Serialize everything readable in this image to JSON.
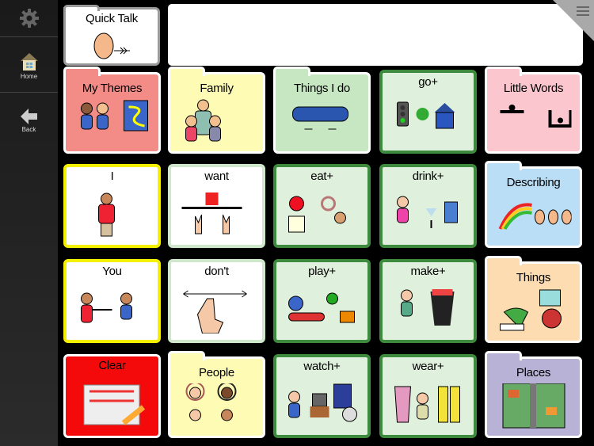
{
  "sidebar": {
    "settings_icon": "gear-icon",
    "home_label": "Home",
    "back_label": "Back"
  },
  "message_bar": {
    "text": ""
  },
  "menu_icon": "hamburger-icon",
  "quick_talk": {
    "label": "Quick Talk",
    "icon": "speaking-face",
    "bg": "#ffffff",
    "border": "#9a9a9a"
  },
  "grid": [
    {
      "label": "My Themes",
      "type": "folder",
      "bg": "#f38b87",
      "border": "#ffffff",
      "icon": "themes"
    },
    {
      "label": "Family",
      "type": "folder",
      "bg": "#fdfbb4",
      "border": "#ffffff",
      "icon": "family"
    },
    {
      "label": "Things I do",
      "type": "folder",
      "bg": "#c6e7c2",
      "border": "#ffffff",
      "icon": "hands"
    },
    {
      "label": "go+",
      "type": "button",
      "bg": "#dff0dc",
      "border": "#3e8a3e",
      "icon": "go"
    },
    {
      "label": "Little Words",
      "type": "folder",
      "bg": "#fcc6cf",
      "border": "#ffffff",
      "icon": "little-words"
    },
    {
      "label": "I",
      "type": "button",
      "bg": "#ffffff",
      "border": "#f5f000",
      "icon": "person"
    },
    {
      "label": "want",
      "type": "button",
      "bg": "#ffffff",
      "border": "#cfe8cc",
      "icon": "want"
    },
    {
      "label": "eat+",
      "type": "button",
      "bg": "#dff0dc",
      "border": "#3e8a3e",
      "icon": "eat"
    },
    {
      "label": "drink+",
      "type": "button",
      "bg": "#dff0dc",
      "border": "#3e8a3e",
      "icon": "drink"
    },
    {
      "label": "Describing",
      "type": "folder",
      "bg": "#b9def5",
      "border": "#ffffff",
      "icon": "describing"
    },
    {
      "label": "You",
      "type": "button",
      "bg": "#ffffff",
      "border": "#f5f000",
      "icon": "you"
    },
    {
      "label": "don't",
      "type": "button",
      "bg": "#ffffff",
      "border": "#cfe8cc",
      "icon": "dont"
    },
    {
      "label": "play+",
      "type": "button",
      "bg": "#dff0dc",
      "border": "#3e8a3e",
      "icon": "play"
    },
    {
      "label": "make+",
      "type": "button",
      "bg": "#dff0dc",
      "border": "#3e8a3e",
      "icon": "make"
    },
    {
      "label": "Things",
      "type": "folder",
      "bg": "#fcdcb0",
      "border": "#ffffff",
      "icon": "things"
    },
    {
      "label": "Clear",
      "type": "button",
      "bg": "#f40a0a",
      "border": "#ffffff",
      "icon": "clear"
    },
    {
      "label": "People",
      "type": "folder",
      "bg": "#fdfbb4",
      "border": "#ffffff",
      "icon": "people"
    },
    {
      "label": "watch+",
      "type": "button",
      "bg": "#dff0dc",
      "border": "#3e8a3e",
      "icon": "watch"
    },
    {
      "label": "wear+",
      "type": "button",
      "bg": "#dff0dc",
      "border": "#3e8a3e",
      "icon": "wear"
    },
    {
      "label": "Places",
      "type": "folder",
      "bg": "#b8b2d6",
      "border": "#ffffff",
      "icon": "places"
    }
  ]
}
